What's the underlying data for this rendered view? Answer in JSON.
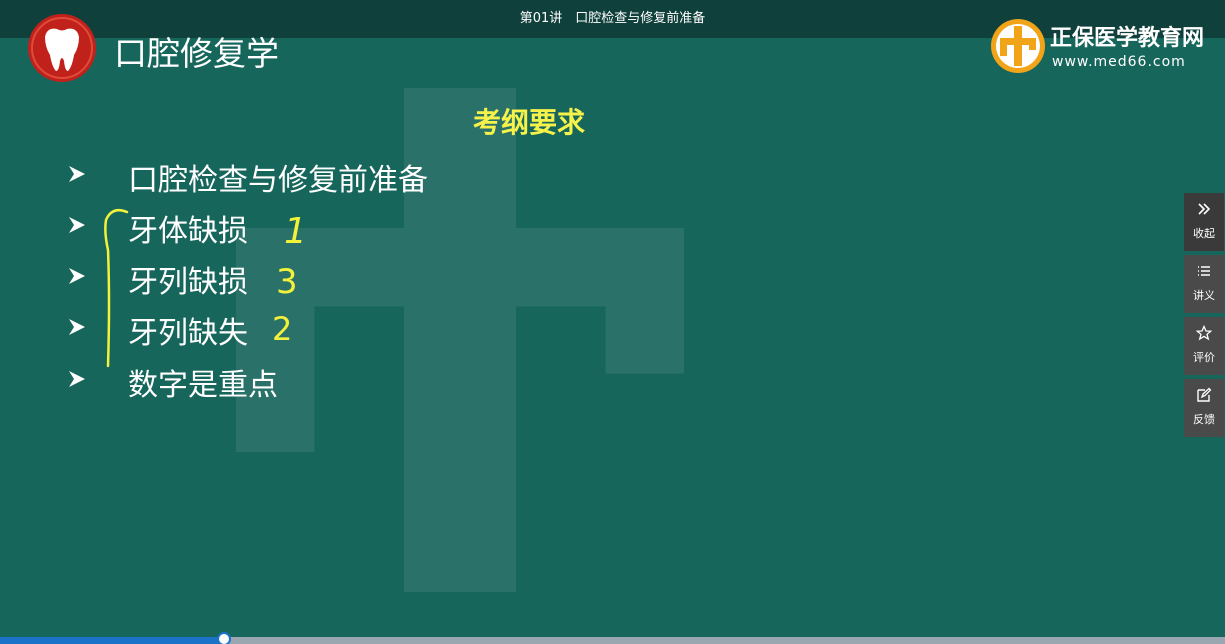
{
  "player": {
    "lecture_title": "第01讲　口腔检查与修复前准备",
    "progress_fraction": 0.183
  },
  "slide": {
    "course_title": "口腔修复学",
    "brand_name": "正保医学教育网",
    "brand_url": "www.med66.com",
    "section_title": "考纲要求",
    "bullets": [
      "口腔检查与修复前准备",
      "牙体缺损",
      "牙列缺损",
      "牙列缺失",
      "数字是重点"
    ],
    "handwritten_marks": [
      "1",
      "3",
      "2"
    ]
  },
  "side_panel": {
    "collapse": "收起",
    "notes": "讲义",
    "rate": "评价",
    "feedback": "反馈"
  },
  "colors": {
    "slide_background": "#17665c",
    "section_title": "#f7f24a",
    "annotation": "#f2f23a",
    "progress_fill": "#1a73c9"
  }
}
